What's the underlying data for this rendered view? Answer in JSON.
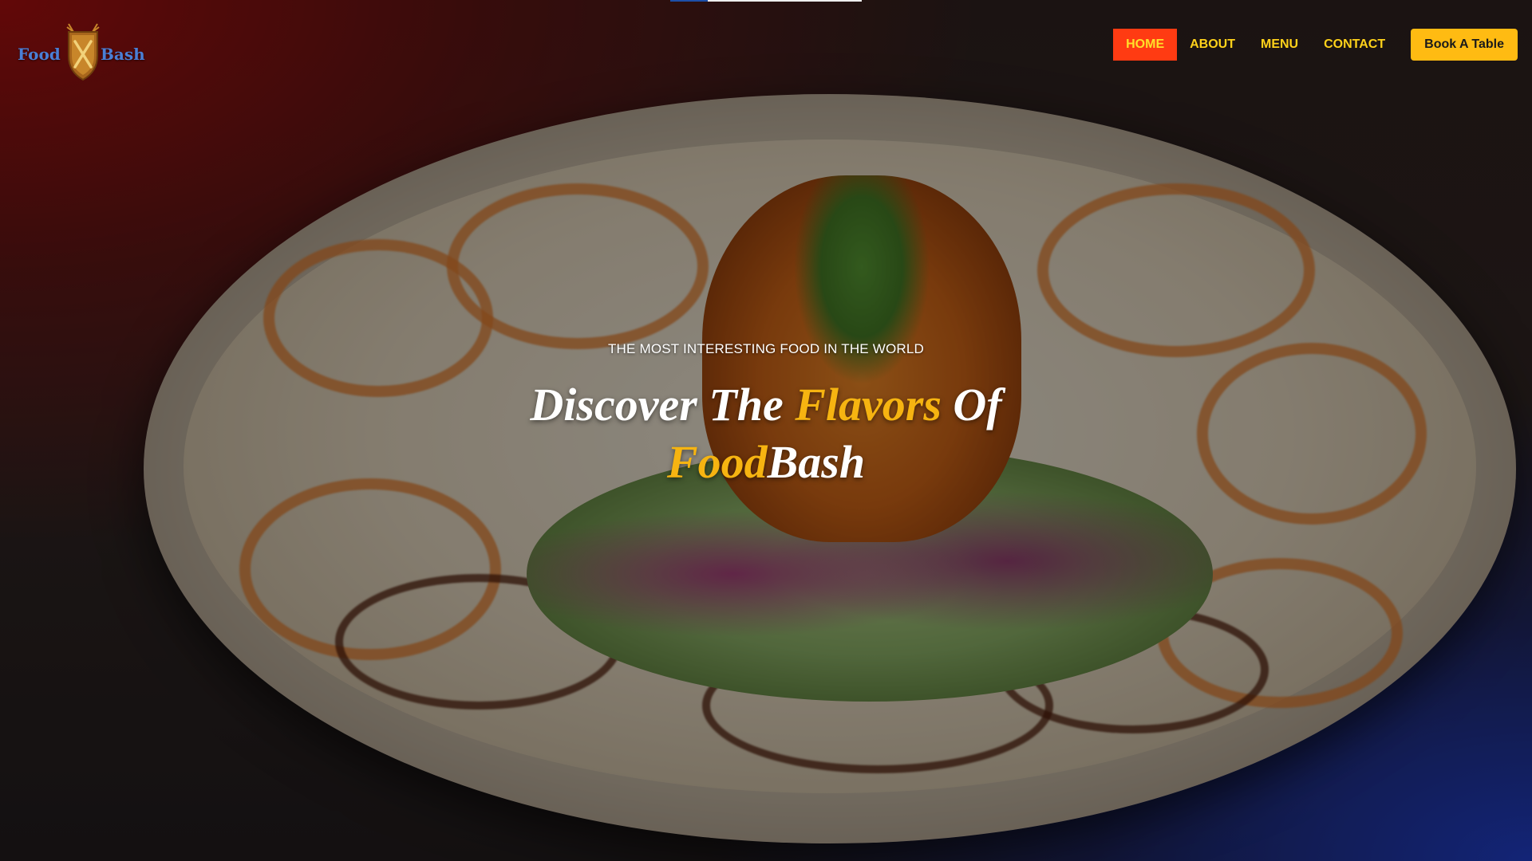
{
  "brand": {
    "left_word": "Food",
    "right_word": "Bash",
    "word_color": "#4a7fd6",
    "shield_color": "#c8862a"
  },
  "nav": {
    "items": [
      {
        "label": "HOME",
        "active": true
      },
      {
        "label": "ABOUT",
        "active": false
      },
      {
        "label": "MENU",
        "active": false
      },
      {
        "label": "CONTACT",
        "active": false
      }
    ],
    "cta_label": "Book A Table",
    "active_bg": "#ff3b12",
    "link_color": "#ffd21a",
    "cta_bg": "#ffbb12"
  },
  "hero": {
    "tagline": "THE MOST INTERESTING FOOD IN THE WORLD",
    "headline": {
      "part1": "Discover The ",
      "accent1": "Flavors",
      "part2": " Of",
      "accent2": "Food",
      "part3": "Bash"
    },
    "accent_color": "#f6b411",
    "background_image": "plated-shrimp-salad-dish"
  }
}
